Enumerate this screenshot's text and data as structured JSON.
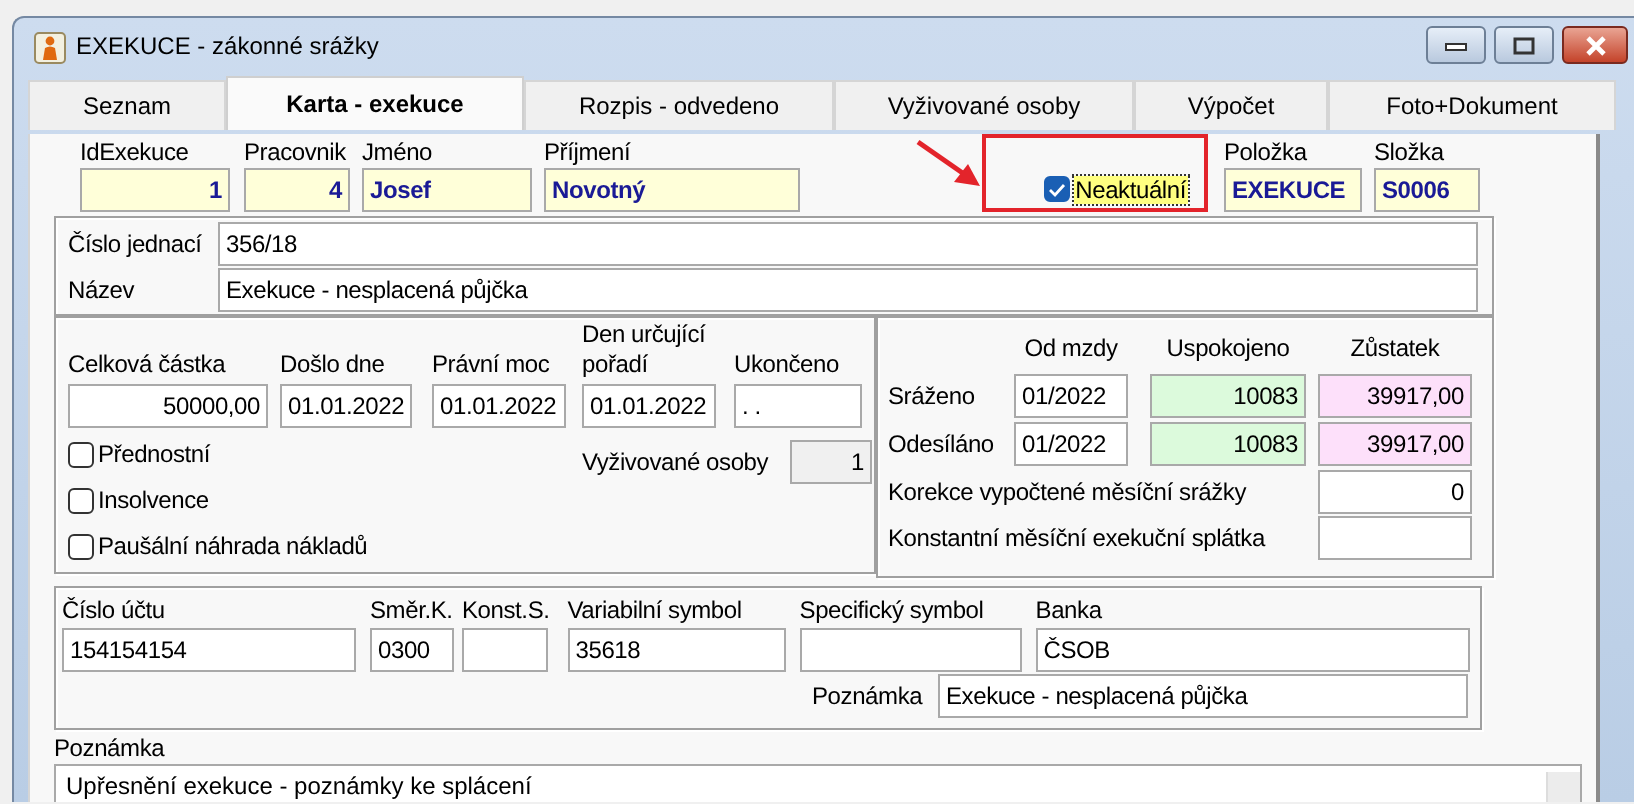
{
  "window": {
    "title": "EXEKUCE - zákonné srážky"
  },
  "tabs": [
    {
      "label": "Seznam",
      "selected": false
    },
    {
      "label": "Karta - exekuce",
      "selected": true
    },
    {
      "label": "Rozpis - odvedeno",
      "selected": false
    },
    {
      "label": "Vyživované osoby",
      "selected": false
    },
    {
      "label": "Výpočet",
      "selected": false
    },
    {
      "label": "Foto+Dokument",
      "selected": false
    }
  ],
  "header": {
    "fields": [
      {
        "label": "IdExekuce",
        "value": "1",
        "kind": "number"
      },
      {
        "label": "Pracovnik",
        "value": "4",
        "kind": "number"
      },
      {
        "label": "Jméno",
        "value": "Josef",
        "kind": "text"
      },
      {
        "label": "Příjmení",
        "value": "Novotný",
        "kind": "text"
      }
    ],
    "inactive": {
      "label": "Neaktuální",
      "checked": true,
      "marked": true
    },
    "codes": [
      {
        "label": "Položka",
        "value": "EXEKUCE"
      },
      {
        "label": "Složka",
        "value": "S0006"
      }
    ]
  },
  "case": [
    {
      "label": "Číslo jednací",
      "value": "356/18"
    },
    {
      "label": "Název",
      "value": "Exekuce - nesplacená půjčka"
    }
  ],
  "amounts": {
    "fields": [
      {
        "label": "Celková částka",
        "value": "50000,00",
        "kind": "number"
      },
      {
        "label": "Došlo dne",
        "value": "01.01.2022",
        "kind": "text"
      },
      {
        "label": "Právní moc",
        "value": "01.01.2022",
        "kind": "text"
      },
      {
        "label": "Den určující pořadí",
        "value": "01.01.2022",
        "kind": "text"
      },
      {
        "label": "Ukončeno",
        "value": ". .",
        "kind": "text"
      }
    ],
    "options": [
      {
        "label": "Přednostní",
        "checked": false
      },
      {
        "label": "Insolvence",
        "checked": false
      },
      {
        "label": "Paušální náhrada nákladů",
        "checked": false
      }
    ],
    "dependents": {
      "label": "Vyživované osoby",
      "value": "1"
    }
  },
  "balance": {
    "columns": [
      "Od mzdy",
      "Uspokojeno",
      "Zůstatek"
    ],
    "rows": [
      {
        "label": "Sráženo",
        "from": "01/2022",
        "paid": "10083",
        "remaining": "39917,00"
      },
      {
        "label": "Odesíláno",
        "from": "01/2022",
        "paid": "10083",
        "remaining": "39917,00"
      }
    ],
    "extra": [
      {
        "label": "Korekce vypočtené měsíční srážky",
        "value": "0"
      },
      {
        "label": "Konstantní měsíční exekuční splátka"
      }
    ]
  },
  "bank": {
    "fields": [
      {
        "label": "Číslo účtu",
        "value": "154154154"
      },
      {
        "label": "Směr.K.",
        "value": "0300"
      },
      {
        "label": "Konst.S."
      },
      {
        "label": "Variabilní symbol",
        "value": "35618"
      },
      {
        "label": "Specifický symbol"
      },
      {
        "label": "Banka",
        "value": "ČSOB"
      }
    ],
    "note": {
      "label": "Poznámka",
      "value": "Exekuce - nesplacená půjčka"
    }
  },
  "note": {
    "label": "Poznámka",
    "value": "Upřesnění exekuce - poznámky ke splácení"
  }
}
